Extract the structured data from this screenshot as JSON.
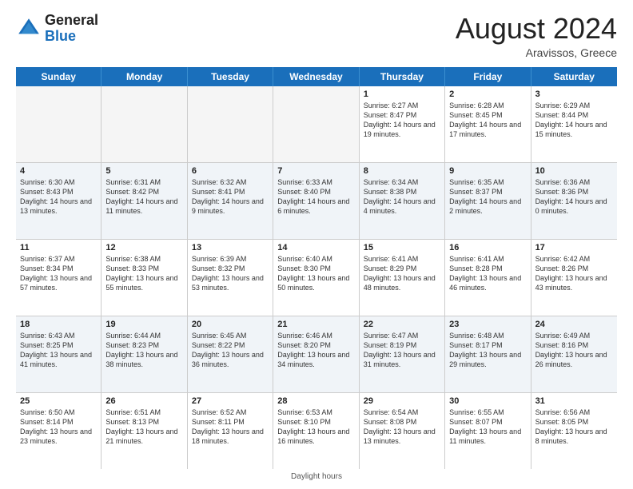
{
  "header": {
    "logo": {
      "general": "General",
      "blue": "Blue"
    },
    "title": "August 2024",
    "location": "Aravissos, Greece"
  },
  "days_of_week": [
    "Sunday",
    "Monday",
    "Tuesday",
    "Wednesday",
    "Thursday",
    "Friday",
    "Saturday"
  ],
  "weeks": [
    [
      {
        "day": "",
        "text": "",
        "empty": true
      },
      {
        "day": "",
        "text": "",
        "empty": true
      },
      {
        "day": "",
        "text": "",
        "empty": true
      },
      {
        "day": "",
        "text": "",
        "empty": true
      },
      {
        "day": "1",
        "text": "Sunrise: 6:27 AM\nSunset: 8:47 PM\nDaylight: 14 hours and 19 minutes.",
        "empty": false
      },
      {
        "day": "2",
        "text": "Sunrise: 6:28 AM\nSunset: 8:45 PM\nDaylight: 14 hours and 17 minutes.",
        "empty": false
      },
      {
        "day": "3",
        "text": "Sunrise: 6:29 AM\nSunset: 8:44 PM\nDaylight: 14 hours and 15 minutes.",
        "empty": false
      }
    ],
    [
      {
        "day": "4",
        "text": "Sunrise: 6:30 AM\nSunset: 8:43 PM\nDaylight: 14 hours and 13 minutes.",
        "empty": false
      },
      {
        "day": "5",
        "text": "Sunrise: 6:31 AM\nSunset: 8:42 PM\nDaylight: 14 hours and 11 minutes.",
        "empty": false
      },
      {
        "day": "6",
        "text": "Sunrise: 6:32 AM\nSunset: 8:41 PM\nDaylight: 14 hours and 9 minutes.",
        "empty": false
      },
      {
        "day": "7",
        "text": "Sunrise: 6:33 AM\nSunset: 8:40 PM\nDaylight: 14 hours and 6 minutes.",
        "empty": false
      },
      {
        "day": "8",
        "text": "Sunrise: 6:34 AM\nSunset: 8:38 PM\nDaylight: 14 hours and 4 minutes.",
        "empty": false
      },
      {
        "day": "9",
        "text": "Sunrise: 6:35 AM\nSunset: 8:37 PM\nDaylight: 14 hours and 2 minutes.",
        "empty": false
      },
      {
        "day": "10",
        "text": "Sunrise: 6:36 AM\nSunset: 8:36 PM\nDaylight: 14 hours and 0 minutes.",
        "empty": false
      }
    ],
    [
      {
        "day": "11",
        "text": "Sunrise: 6:37 AM\nSunset: 8:34 PM\nDaylight: 13 hours and 57 minutes.",
        "empty": false
      },
      {
        "day": "12",
        "text": "Sunrise: 6:38 AM\nSunset: 8:33 PM\nDaylight: 13 hours and 55 minutes.",
        "empty": false
      },
      {
        "day": "13",
        "text": "Sunrise: 6:39 AM\nSunset: 8:32 PM\nDaylight: 13 hours and 53 minutes.",
        "empty": false
      },
      {
        "day": "14",
        "text": "Sunrise: 6:40 AM\nSunset: 8:30 PM\nDaylight: 13 hours and 50 minutes.",
        "empty": false
      },
      {
        "day": "15",
        "text": "Sunrise: 6:41 AM\nSunset: 8:29 PM\nDaylight: 13 hours and 48 minutes.",
        "empty": false
      },
      {
        "day": "16",
        "text": "Sunrise: 6:41 AM\nSunset: 8:28 PM\nDaylight: 13 hours and 46 minutes.",
        "empty": false
      },
      {
        "day": "17",
        "text": "Sunrise: 6:42 AM\nSunset: 8:26 PM\nDaylight: 13 hours and 43 minutes.",
        "empty": false
      }
    ],
    [
      {
        "day": "18",
        "text": "Sunrise: 6:43 AM\nSunset: 8:25 PM\nDaylight: 13 hours and 41 minutes.",
        "empty": false
      },
      {
        "day": "19",
        "text": "Sunrise: 6:44 AM\nSunset: 8:23 PM\nDaylight: 13 hours and 38 minutes.",
        "empty": false
      },
      {
        "day": "20",
        "text": "Sunrise: 6:45 AM\nSunset: 8:22 PM\nDaylight: 13 hours and 36 minutes.",
        "empty": false
      },
      {
        "day": "21",
        "text": "Sunrise: 6:46 AM\nSunset: 8:20 PM\nDaylight: 13 hours and 34 minutes.",
        "empty": false
      },
      {
        "day": "22",
        "text": "Sunrise: 6:47 AM\nSunset: 8:19 PM\nDaylight: 13 hours and 31 minutes.",
        "empty": false
      },
      {
        "day": "23",
        "text": "Sunrise: 6:48 AM\nSunset: 8:17 PM\nDaylight: 13 hours and 29 minutes.",
        "empty": false
      },
      {
        "day": "24",
        "text": "Sunrise: 6:49 AM\nSunset: 8:16 PM\nDaylight: 13 hours and 26 minutes.",
        "empty": false
      }
    ],
    [
      {
        "day": "25",
        "text": "Sunrise: 6:50 AM\nSunset: 8:14 PM\nDaylight: 13 hours and 23 minutes.",
        "empty": false
      },
      {
        "day": "26",
        "text": "Sunrise: 6:51 AM\nSunset: 8:13 PM\nDaylight: 13 hours and 21 minutes.",
        "empty": false
      },
      {
        "day": "27",
        "text": "Sunrise: 6:52 AM\nSunset: 8:11 PM\nDaylight: 13 hours and 18 minutes.",
        "empty": false
      },
      {
        "day": "28",
        "text": "Sunrise: 6:53 AM\nSunset: 8:10 PM\nDaylight: 13 hours and 16 minutes.",
        "empty": false
      },
      {
        "day": "29",
        "text": "Sunrise: 6:54 AM\nSunset: 8:08 PM\nDaylight: 13 hours and 13 minutes.",
        "empty": false
      },
      {
        "day": "30",
        "text": "Sunrise: 6:55 AM\nSunset: 8:07 PM\nDaylight: 13 hours and 11 minutes.",
        "empty": false
      },
      {
        "day": "31",
        "text": "Sunrise: 6:56 AM\nSunset: 8:05 PM\nDaylight: 13 hours and 8 minutes.",
        "empty": false
      }
    ]
  ],
  "footer": "Daylight hours"
}
